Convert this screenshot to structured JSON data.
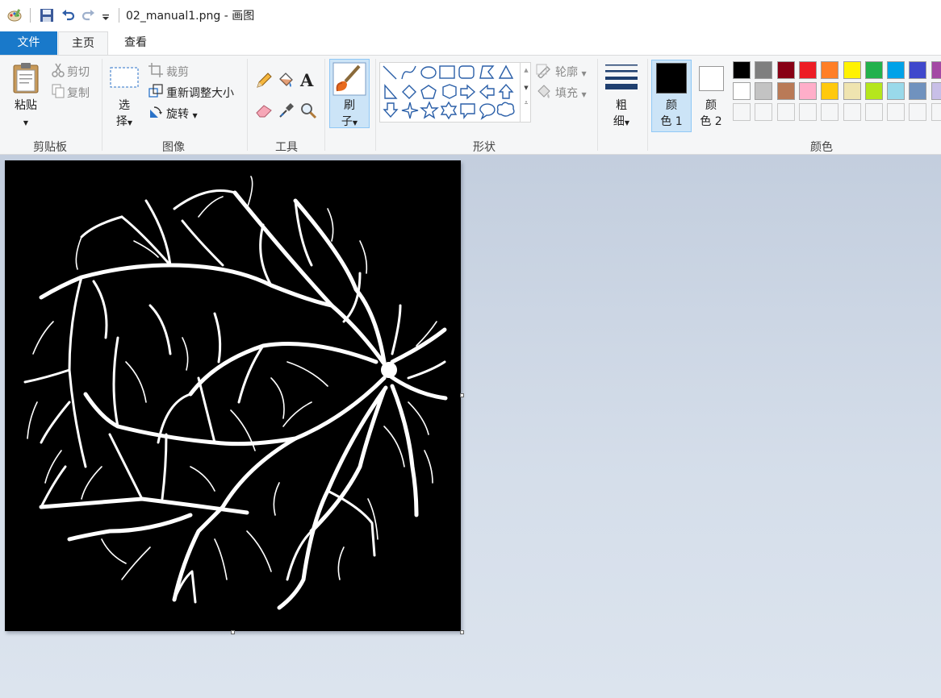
{
  "title_bar": {
    "document_title": "02_manual1.png - 画图",
    "icons": [
      "paint-app-icon",
      "save-icon",
      "undo-icon",
      "redo-icon",
      "customize-quick-access-icon"
    ]
  },
  "tabs": {
    "file": "文件",
    "home": "主页",
    "view": "查看"
  },
  "ribbon": {
    "clipboard": {
      "paste": "粘贴",
      "cut": "剪切",
      "copy": "复制",
      "group_label": "剪贴板"
    },
    "image": {
      "select_1": "选",
      "select_2": "择",
      "crop": "裁剪",
      "resize": "重新调整大小",
      "rotate": "旋转",
      "group_label": "图像"
    },
    "tools": {
      "text_tool": "A",
      "group_label": "工具",
      "icons": [
        "pencil-icon",
        "fill-bucket-icon",
        "text-icon",
        "eraser-icon",
        "color-picker-icon",
        "magnifier-icon"
      ]
    },
    "brushes": {
      "label_1": "刷",
      "label_2": "子"
    },
    "shapes": {
      "outline": "轮廓",
      "fill": "填充",
      "group_label": "形状",
      "icons": [
        "line",
        "curve",
        "oval",
        "rectangle",
        "rounded-rectangle",
        "polygon",
        "triangle",
        "right-triangle",
        "diamond",
        "pentagon",
        "hexagon",
        "right-arrow",
        "left-arrow",
        "up-arrow",
        "down-arrow",
        "four-point-star",
        "five-point-star",
        "six-point-star",
        "rounded-callout",
        "oval-callout",
        "cloud-callout"
      ]
    },
    "size": {
      "label_1": "粗",
      "label_2": "细"
    },
    "colors": {
      "color1_label_1": "颜",
      "color1_label_2": "色 1",
      "color2_label_1": "颜",
      "color2_label_2": "色 2",
      "color1_value": "#000000",
      "color2_value": "#ffffff",
      "group_label": "颜色",
      "palette_row1": [
        "#000000",
        "#7f7f7f",
        "#880015",
        "#ed1c24",
        "#ff7f27",
        "#fff200",
        "#22b14c",
        "#00a2e8",
        "#3f48cc",
        "#a349a4"
      ],
      "palette_row2": [
        "#ffffff",
        "#c3c3c3",
        "#b97a57",
        "#ffaec9",
        "#ffc90e",
        "#efe4b0",
        "#b5e61d",
        "#99d9ea",
        "#7092be",
        "#c8bfe7"
      ],
      "palette_row3": [
        "#f5f6f7",
        "#f5f6f7",
        "#f5f6f7",
        "#f5f6f7",
        "#f5f6f7",
        "#f5f6f7",
        "#f5f6f7",
        "#f5f6f7",
        "#f5f6f7",
        "#f5f6f7"
      ]
    }
  },
  "canvas": {
    "image_content": "retinal vessel segmentation mask (white vessels on black background)"
  }
}
